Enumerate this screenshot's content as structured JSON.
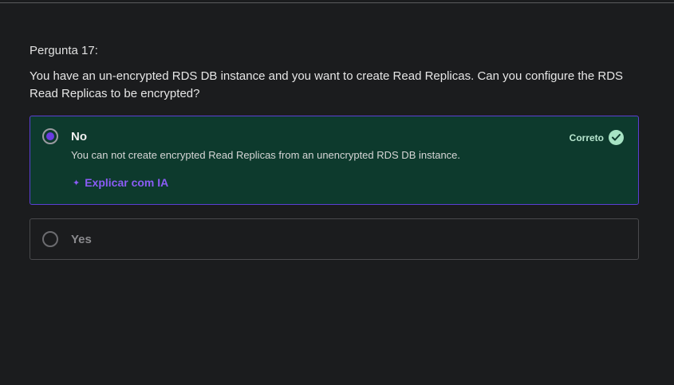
{
  "question": {
    "number_label": "Pergunta 17:",
    "text": "You have an un-encrypted RDS DB instance and you want to create Read Replicas. Can you configure the RDS Read Replicas to be encrypted?"
  },
  "options": [
    {
      "label": "No",
      "selected": true,
      "status": "Correto",
      "explanation": "You can not create encrypted Read Replicas from an unencrypted RDS DB instance.",
      "ai_link": "Explicar com IA"
    },
    {
      "label": "Yes",
      "selected": false
    }
  ],
  "colors": {
    "correct_bg": "#0d3a2d",
    "selected_border": "#5b3fd4",
    "accent": "#8b5cf6",
    "check": "#a7e3c4"
  },
  "icons": [
    "radio-selected-icon",
    "radio-empty-icon",
    "sparkle-icon",
    "check-circle-icon"
  ]
}
